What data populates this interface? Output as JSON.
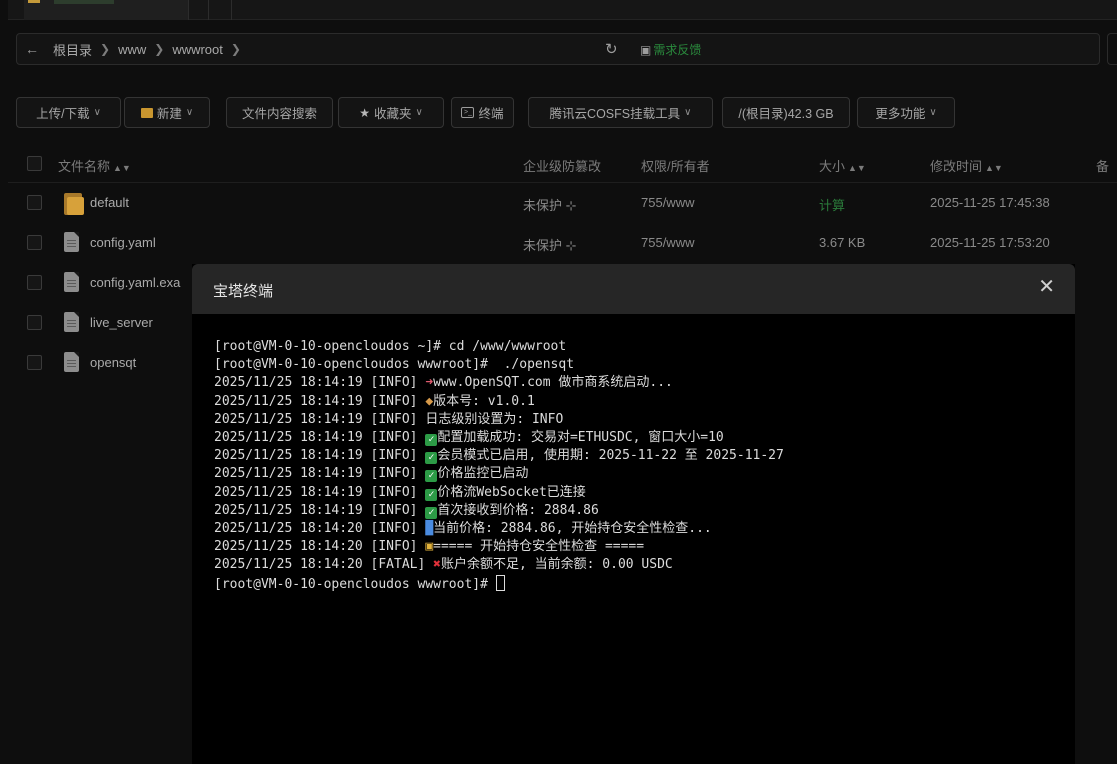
{
  "breadcrumb": {
    "items": [
      "根目录",
      "www",
      "wwwroot"
    ],
    "refresh_icon": "refresh-icon",
    "feedback_label": "需求反馈"
  },
  "toolbar": {
    "upload": "上传/下载",
    "new": "新建",
    "search_content": "文件内容搜索",
    "favorites": "收藏夹",
    "terminal": "终端",
    "cosfs": "腾讯云COSFS挂载工具",
    "disk": "/(根目录)42.3 GB",
    "more": "更多功能"
  },
  "table": {
    "headers": {
      "name": "文件名称",
      "protect": "企业级防篡改",
      "perm": "权限/所有者",
      "size": "大小",
      "mtime": "修改时间",
      "note": "备"
    },
    "rows": [
      {
        "name": "default",
        "type": "folder",
        "protect": "未保护",
        "perm": "755/www",
        "size": "计算",
        "mtime": "2025-11-25 17:45:38"
      },
      {
        "name": "config.yaml",
        "type": "file",
        "protect": "未保护",
        "perm": "755/www",
        "size": "3.67 KB",
        "mtime": "2025-11-25 17:53:20"
      },
      {
        "name": "config.yaml.exa",
        "type": "file"
      },
      {
        "name": "live_server",
        "type": "file"
      },
      {
        "name": "opensqt",
        "type": "file"
      }
    ]
  },
  "terminal": {
    "title": "宝塔终端",
    "lines": [
      "[root@VM-0-10-opencloudos ~]# cd /www/wwwroot",
      "[root@VM-0-10-opencloudos wwwroot]#  ./opensqt",
      "2025/11/25 18:14:19 [INFO] ",
      "www.OpenSQT.com 做市商系统启动...",
      "2025/11/25 18:14:19 [INFO] ",
      "版本号: v1.0.1",
      "2025/11/25 18:14:19 [INFO] 日志级别设置为: INFO",
      "2025/11/25 18:14:19 [INFO] ",
      "配置加载成功: 交易对=ETHUSDC, 窗口大小=10",
      "2025/11/25 18:14:19 [INFO] ",
      "会员模式已启用, 使用期: 2025-11-22 至 2025-11-27",
      "2025/11/25 18:14:19 [INFO] ",
      "价格监控已启动",
      "2025/11/25 18:14:19 [INFO] ",
      "价格流WebSocket已连接",
      "2025/11/25 18:14:19 [INFO] ",
      "首次接收到价格: 2884.86",
      "2025/11/25 18:14:20 [INFO] ",
      "当前价格: 2884.86, 开始持仓安全性检查...",
      "2025/11/25 18:14:20 [INFO] ",
      "===== 开始持仓安全性检查 =====",
      "2025/11/25 18:14:20 [FATAL] ",
      "账户余额不足, 当前余额: 0.00 USDC",
      "[root@VM-0-10-opencloudos wwwroot]# "
    ]
  },
  "colors": {
    "background": "#0e0e0e",
    "accent_green": "#2a8a3d",
    "folder": "#d7a13a"
  }
}
